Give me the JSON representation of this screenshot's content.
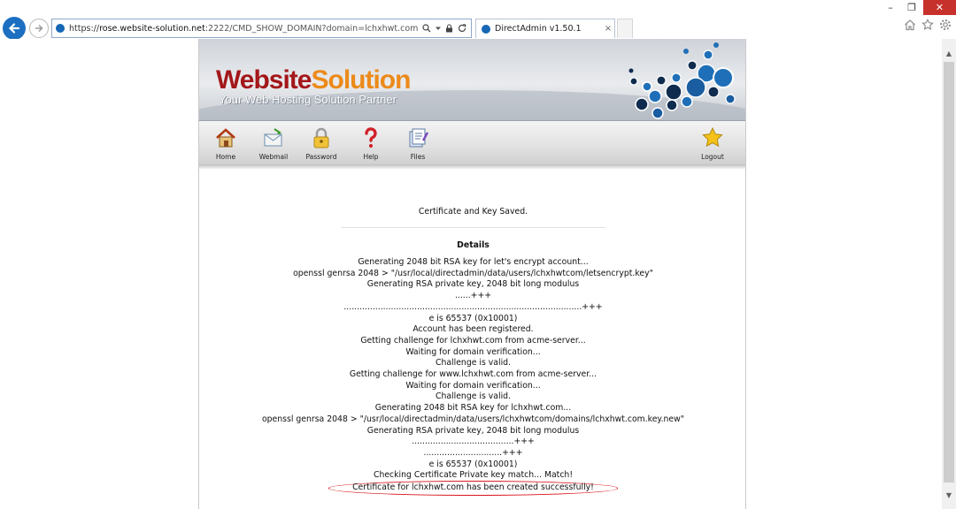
{
  "browser": {
    "url": {
      "scheme": "https://",
      "host": "rose.website-solution.net",
      "rest": ":2222/CMD_SHOW_DOMAIN?domain=lchxhwt.com"
    },
    "tab_title": "DirectAdmin v1.50.1",
    "tab_close": "×",
    "window_buttons": {
      "minimize": "–",
      "restore": "❐",
      "close": "✕"
    },
    "icons": [
      "home-icon",
      "star-icon",
      "gear-icon"
    ]
  },
  "banner": {
    "brand_word1": "Website",
    "brand_word2": "Solution",
    "tagline": "Your Web Hosting Solution Partner",
    "colors": {
      "brand_red": "#a3171a",
      "brand_orange": "#ec8a1a",
      "bubble_blue": "#1f6fb8",
      "bubble_navy": "#0f2c4f"
    }
  },
  "nav": {
    "home": "Home",
    "webmail": "Webmail",
    "password": "Password",
    "help": "Help",
    "files": "Files",
    "logout": "Logout"
  },
  "content": {
    "saved_message": "Certificate and Key Saved.",
    "details_heading": "Details",
    "log_lines": [
      "Generating 2048 bit RSA key for let's encrypt account...",
      "openssl genrsa 2048 > \"/usr/local/directadmin/data/users/lchxhwtcom/letsencrypt.key\"",
      "Generating RSA private key, 2048 bit long modulus",
      "......+++",
      "...........................................................................................+++",
      "e is 65537 (0x10001)",
      "Account has been registered.",
      "Getting challenge for lchxhwt.com from acme-server...",
      "Waiting for domain verification...",
      "Challenge is valid.",
      "Getting challenge for www.lchxhwt.com from acme-server...",
      "Waiting for domain verification...",
      "Challenge is valid.",
      "Generating 2048 bit RSA key for lchxhwt.com...",
      "openssl genrsa 2048 > \"/usr/local/directadmin/data/users/lchxhwtcom/domains/lchxhwt.com.key.new\"",
      "Generating RSA private key, 2048 bit long modulus",
      ".......................................+++",
      "..............................+++",
      "e is 65537 (0x10001)",
      "Checking Certificate Private key match... Match!"
    ],
    "success_line": "Certificate for lchxhwt.com has been created successfully!"
  }
}
